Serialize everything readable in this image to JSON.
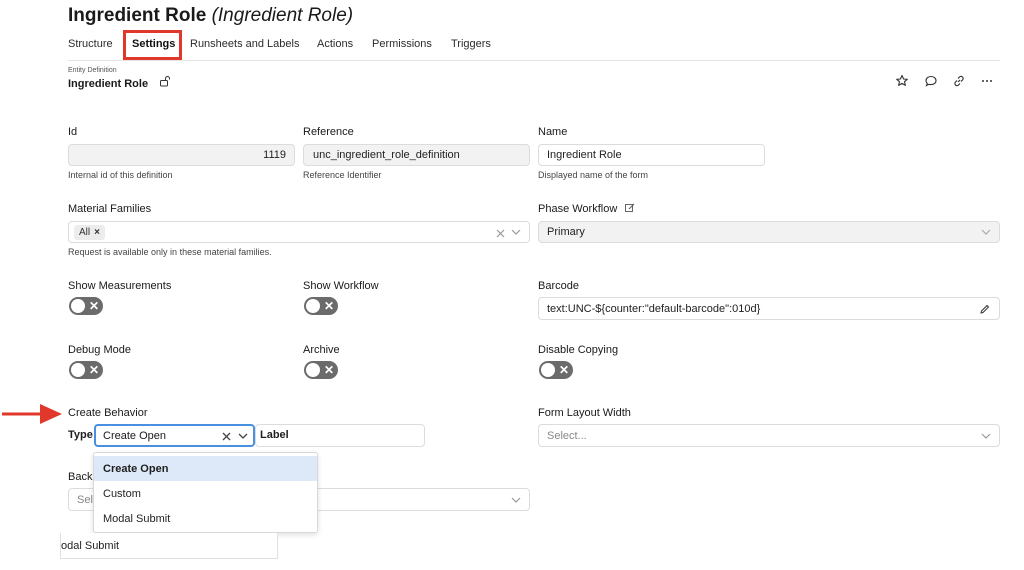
{
  "page": {
    "title": "Ingredient Role",
    "subtitle": "(Ingredient Role)"
  },
  "tabs": [
    {
      "label": "Structure"
    },
    {
      "label": "Settings",
      "active": true
    },
    {
      "label": "Runsheets and Labels"
    },
    {
      "label": "Actions"
    },
    {
      "label": "Permissions"
    },
    {
      "label": "Triggers"
    }
  ],
  "entity": {
    "caption": "Entity Definition",
    "name": "Ingredient Role"
  },
  "header_icons": [
    "star-icon",
    "comment-icon",
    "link-icon",
    "more-icon"
  ],
  "fields": {
    "id": {
      "label": "Id",
      "value": "1119",
      "help": "Internal id of this definition"
    },
    "reference": {
      "label": "Reference",
      "value": "unc_ingredient_role_definition",
      "help": "Reference Identifier"
    },
    "name": {
      "label": "Name",
      "value": "Ingredient Role",
      "help": "Displayed name of the form"
    },
    "material_families": {
      "label": "Material Families",
      "chip": "All",
      "chip_remove": "×",
      "help": "Request is available only in these material families."
    },
    "phase_workflow": {
      "label": "Phase Workflow",
      "value": "Primary"
    },
    "show_measurements": {
      "label": "Show Measurements",
      "on": false
    },
    "show_workflow": {
      "label": "Show Workflow",
      "on": false
    },
    "barcode": {
      "label": "Barcode",
      "value": "text:UNC-${counter:\"default-barcode\":010d}"
    },
    "debug_mode": {
      "label": "Debug Mode",
      "on": false
    },
    "archive": {
      "label": "Archive",
      "on": false
    },
    "disable_copying": {
      "label": "Disable Copying",
      "on": false
    },
    "create_behavior": {
      "label": "Create Behavior",
      "type_label": "Type",
      "type_value": "Create Open",
      "label_label": "Label"
    },
    "form_layout_width": {
      "label": "Form Layout Width",
      "placeholder": "Select..."
    },
    "back_partial": {
      "label": "Back",
      "placeholder_partial": "Sele"
    }
  },
  "toggle_off_glyph": "✕",
  "dropdown": {
    "options": [
      "Create Open",
      "Custom",
      "Modal Submit"
    ],
    "selected": "Create Open"
  },
  "ghost_option": "odal Submit",
  "colors": {
    "highlight": "#e0382b",
    "focus": "#4a90e2",
    "selected_bg": "#dde9f8",
    "toggle": "#6b6b6b"
  }
}
